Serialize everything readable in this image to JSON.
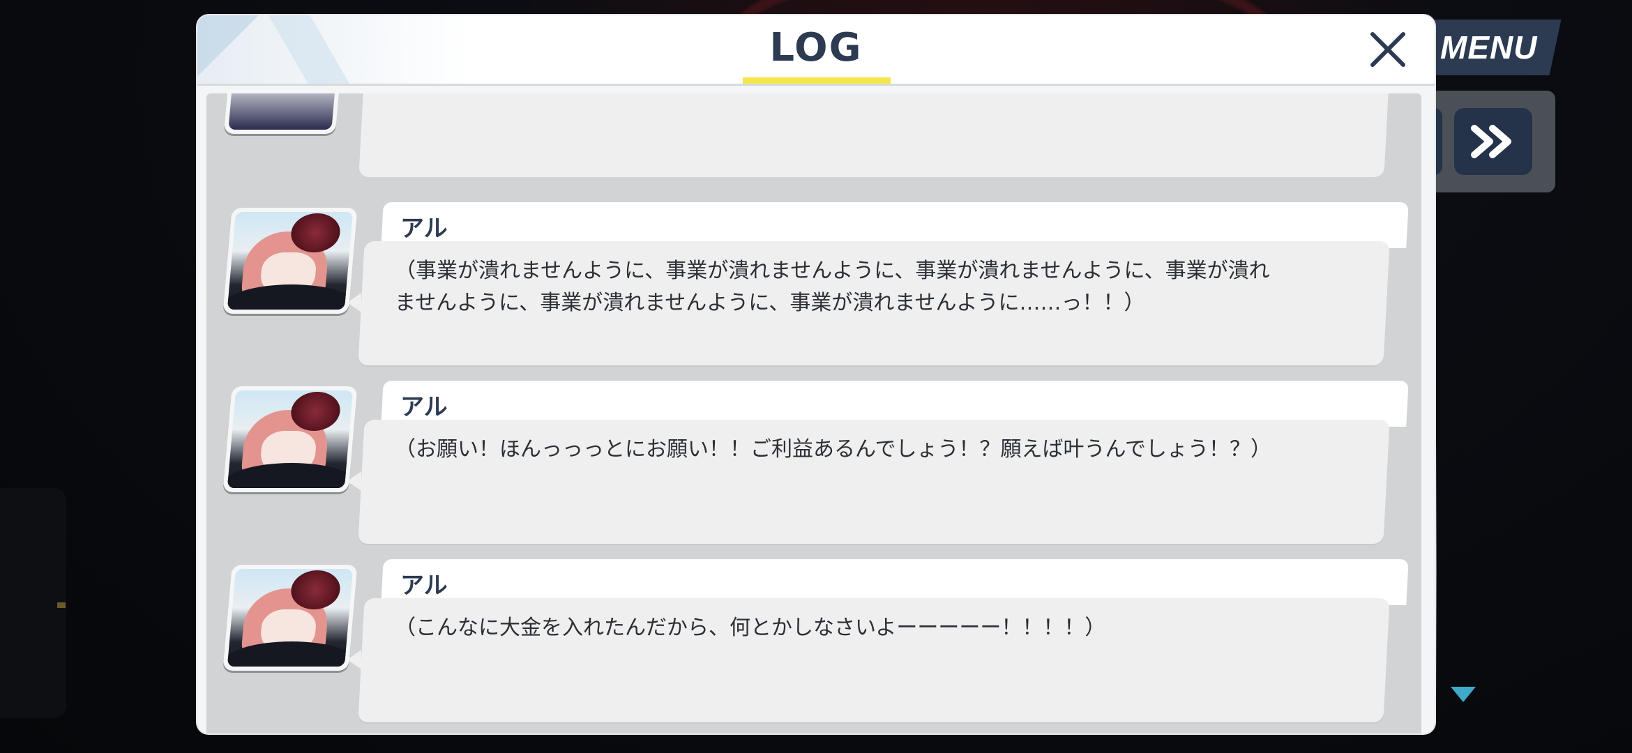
{
  "background": {
    "menu_label": "MENU"
  },
  "log": {
    "title": "LOG",
    "accent_color": "#f3e64a",
    "title_color": "#2d3b52",
    "close_icon": "close-icon",
    "entries": [
      {
        "speaker": "アル",
        "text_lines": [
          "（事業が潰れませんように、事業が潰れませんように、事業が潰れませんように、事業が潰れ",
          "ませんように、事業が潰れませんように、事業が潰れませんように……っ！！）"
        ]
      },
      {
        "speaker": "アル",
        "text_lines": [
          "（お願い！ほんっっっとにお願い！！ご利益あるんでしょう！？願えば叶うんでしょう！？）"
        ]
      },
      {
        "speaker": "アル",
        "text_lines": [
          "（こんなに大金を入れたんだから、何とかしなさいよーーーーー！！！！）"
        ]
      }
    ]
  }
}
